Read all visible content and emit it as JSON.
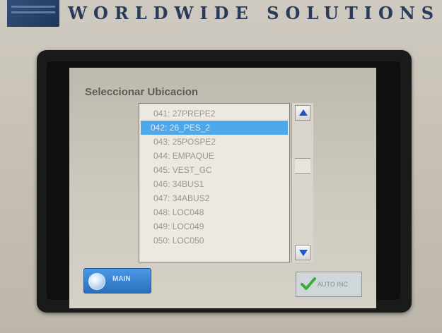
{
  "device": {
    "brand": "WORLDWIDE SOLUTIONS"
  },
  "screen": {
    "title": "Seleccionar Ubicacion",
    "locations": [
      "041: 27PREPE2",
      "042: 26_PES_2",
      "043: 25POSPE2",
      "044: EMPAQUE",
      "045: VEST_GC",
      "046: 34BUS1",
      "047: 34ABUS2",
      "048: LOC048",
      "049: LOC049",
      "050: LOC050"
    ],
    "selected_index": 1,
    "main_button_label": "MAIN",
    "auto_inc_label": "AUTO INC"
  },
  "icons": {
    "scroll_up": "up-arrow-icon",
    "scroll_down": "down-arrow-icon",
    "main": "globe-icon",
    "auto_inc": "check-icon"
  },
  "colors": {
    "selection": "#4ea8ea",
    "arrow": "#2356c4",
    "main_button": "#2a6fbd",
    "check": "#3caa3c"
  }
}
